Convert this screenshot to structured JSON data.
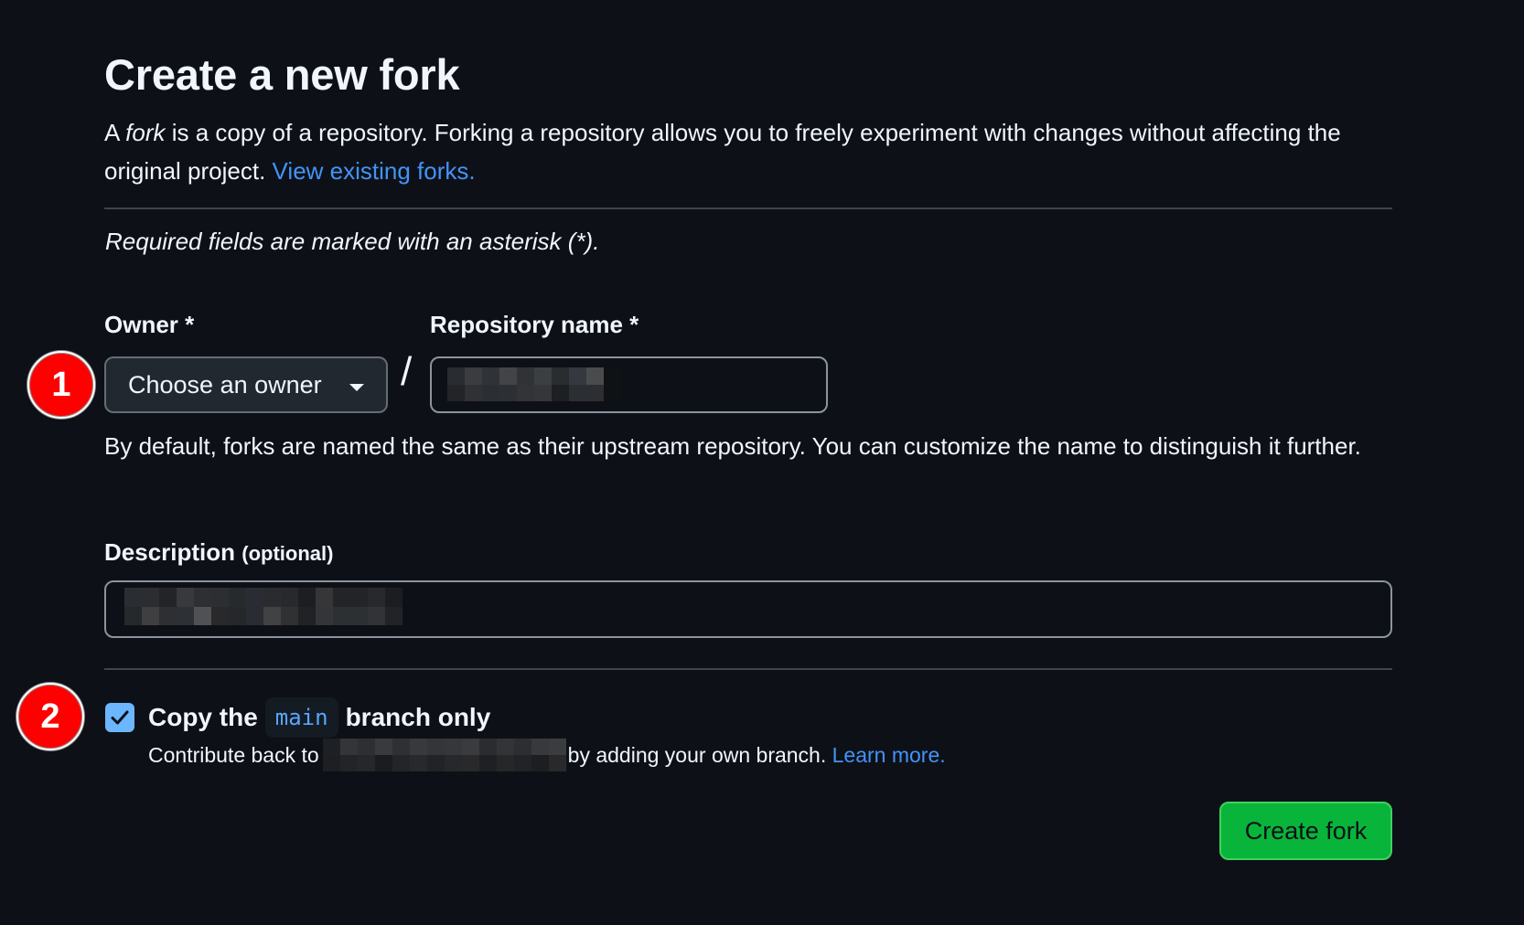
{
  "page": {
    "title": "Create a new fork",
    "intro_prefix": "A ",
    "intro_em": "fork",
    "intro_text": " is a copy of a repository. Forking a repository allows you to freely experiment with changes without affecting the original project. ",
    "intro_link": "View existing forks.",
    "required_note": "Required fields are marked with an asterisk (*)."
  },
  "form": {
    "owner": {
      "label": "Owner *",
      "selected": "Choose an owner"
    },
    "separator": "/",
    "repo_name": {
      "label": "Repository name *",
      "value": "",
      "redacted": true
    },
    "repo_help": "By default, forks are named the same as their upstream repository. You can customize the name to distinguish it further.",
    "description": {
      "label": "Description",
      "label_suffix": "(optional)",
      "value": "",
      "redacted": true
    },
    "copy_branch": {
      "checked": true,
      "label_prefix": "Copy the",
      "branch": "main",
      "label_suffix": "branch only",
      "desc_prefix": "Contribute back to",
      "desc_redacted": true,
      "desc_suffix": "by adding your own branch.",
      "desc_link": "Learn more."
    },
    "submit_label": "Create fork"
  },
  "annotations": {
    "markers": [
      {
        "label": "1",
        "target": "owner-select"
      },
      {
        "label": "2",
        "target": "copy-main-branch-checkbox"
      }
    ]
  },
  "colors": {
    "background": "#0d1117",
    "link": "#4493f8",
    "primary_button": "#09b43a",
    "checkbox": "#6cb6ff",
    "marker": "#ff0000"
  }
}
